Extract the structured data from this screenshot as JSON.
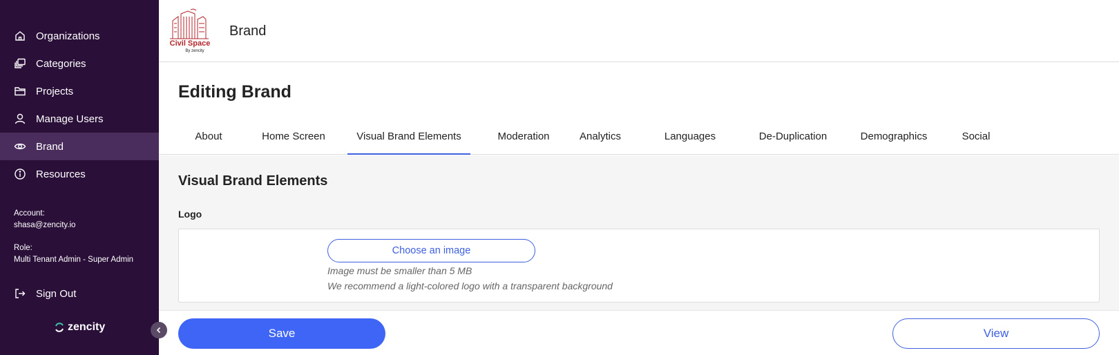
{
  "sidebar": {
    "items": [
      {
        "label": "Organizations",
        "icon": "home-icon"
      },
      {
        "label": "Categories",
        "icon": "layers-icon"
      },
      {
        "label": "Projects",
        "icon": "folder-icon"
      },
      {
        "label": "Manage Users",
        "icon": "user-icon"
      },
      {
        "label": "Brand",
        "icon": "eye-icon",
        "active": true
      },
      {
        "label": "Resources",
        "icon": "info-icon"
      }
    ],
    "account_label": "Account:",
    "account_value": "shasa@zencity.io",
    "role_label": "Role:",
    "role_value": "Multi Tenant Admin - Super Admin",
    "signout_label": "Sign Out",
    "footer_brand": "zencity"
  },
  "header": {
    "logo_text": "Civil Space",
    "logo_subtext": "By zencity",
    "title": "Brand"
  },
  "page": {
    "title": "Editing Brand"
  },
  "tabs": [
    {
      "label": "About"
    },
    {
      "label": "Home Screen"
    },
    {
      "label": "Visual Brand Elements",
      "active": true
    },
    {
      "label": "Moderation"
    },
    {
      "label": "Analytics"
    },
    {
      "label": "Languages"
    },
    {
      "label": "De-Duplication"
    },
    {
      "label": "Demographics"
    },
    {
      "label": "Social"
    }
  ],
  "section": {
    "title": "Visual Brand Elements",
    "logo_label": "Logo",
    "choose_button": "Choose an image",
    "hint_size": "Image must be smaller than 5 MB",
    "hint_recommend": "We recommend a light-colored logo with a transparent background"
  },
  "footer": {
    "save_label": "Save",
    "view_label": "View"
  },
  "colors": {
    "sidebar_bg": "#2a0f39",
    "sidebar_active": "#4a2d5c",
    "accent": "#3e65f5",
    "logo_red": "#b3262b"
  }
}
